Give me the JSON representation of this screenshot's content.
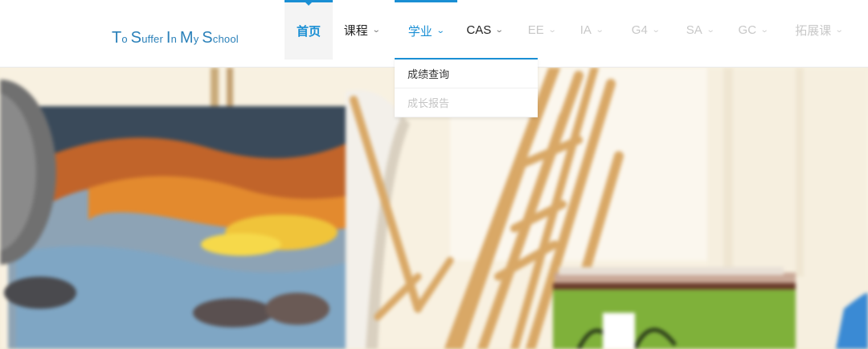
{
  "logo": {
    "parts": [
      {
        "cap": "T",
        "rest": "o "
      },
      {
        "cap": "S",
        "rest": "uffer "
      },
      {
        "cap": "I",
        "rest": "n "
      },
      {
        "cap": "M",
        "rest": "y "
      },
      {
        "cap": "S",
        "rest": "chool"
      }
    ]
  },
  "nav": {
    "items": [
      {
        "label": "首页",
        "state": "active"
      },
      {
        "label": "课程",
        "state": "normal",
        "has_dropdown": true
      },
      {
        "label": "学业",
        "state": "open",
        "has_dropdown": true
      },
      {
        "label": "CAS",
        "state": "normal",
        "has_dropdown": true
      },
      {
        "label": "EE",
        "state": "dim",
        "has_dropdown": true
      },
      {
        "label": "IA",
        "state": "dim",
        "has_dropdown": true
      },
      {
        "label": "G4",
        "state": "dim",
        "has_dropdown": true
      },
      {
        "label": "SA",
        "state": "dim",
        "has_dropdown": true
      },
      {
        "label": "GC",
        "state": "dim",
        "has_dropdown": true
      },
      {
        "label": "拓展课",
        "state": "dim",
        "has_dropdown": true
      }
    ]
  },
  "dropdown": {
    "items": [
      {
        "label": "成绩查询",
        "state": "normal"
      },
      {
        "label": "成长报告",
        "state": "dim"
      }
    ]
  },
  "colors": {
    "accent": "#1a8fd4",
    "logo": "#2a80b9",
    "dim_text": "#c8c8c8"
  },
  "hero": {
    "description_icon": "art-studio-photo"
  }
}
